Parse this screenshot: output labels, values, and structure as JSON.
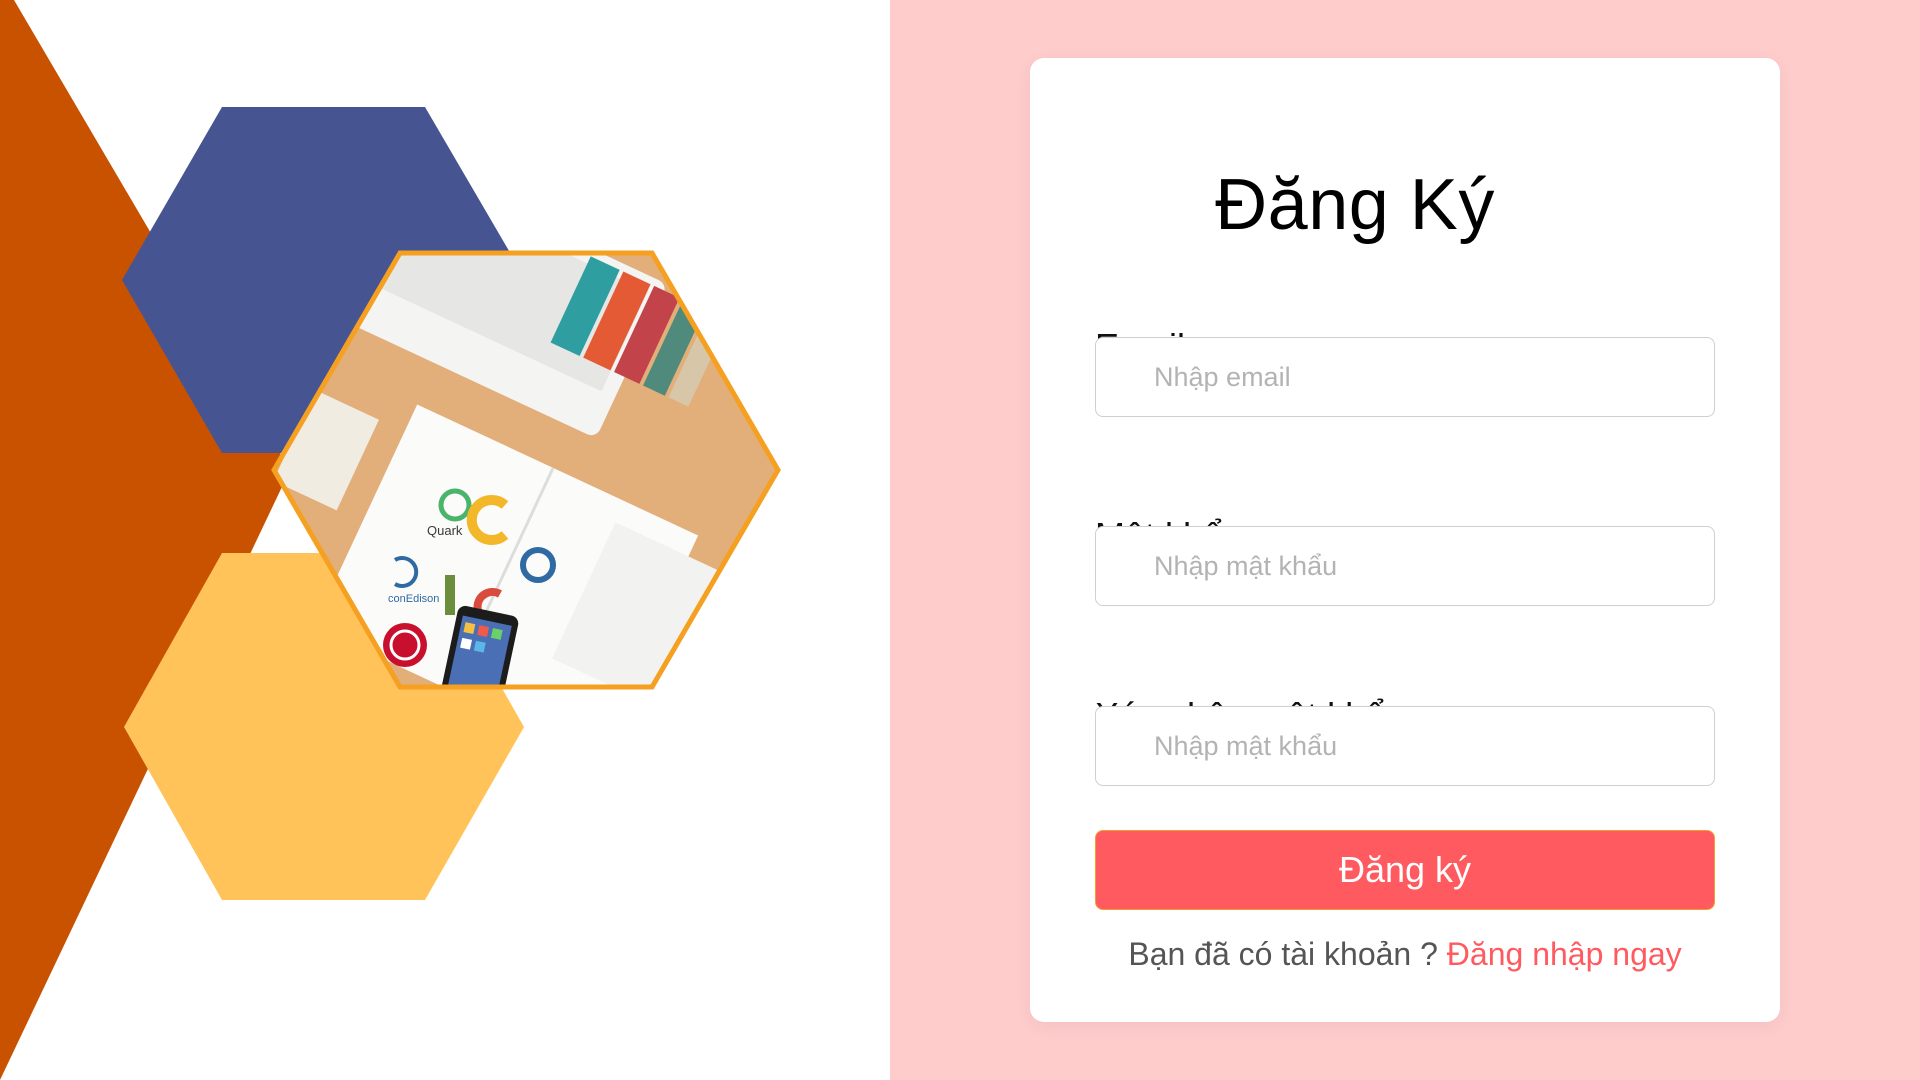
{
  "colors": {
    "orange_shape": "#c95200",
    "blue_hexagon": "#465491",
    "yellow_hexagon": "#ffc35a",
    "photo_border": "#f5a020",
    "right_background": "#ffcccc",
    "accent": "#ff5a5f"
  },
  "illustration": {
    "photo_icon": "desk-workspace-photo-icon",
    "photo_logos": [
      "Quark",
      "conEdison"
    ]
  },
  "form": {
    "title": "Đăng Ký",
    "email": {
      "label": "Email",
      "placeholder": "Nhập email"
    },
    "password": {
      "label": "Mật khẩu",
      "placeholder": "Nhập mật khẩu"
    },
    "confirm_password": {
      "label": "Xác nhận mật khẩu",
      "placeholder": "Nhập mật khẩu"
    },
    "submit_label": "Đăng ký",
    "footer": {
      "prompt": "Bạn đã có tài khoản ? ",
      "link": "Đăng nhập ngay"
    }
  }
}
